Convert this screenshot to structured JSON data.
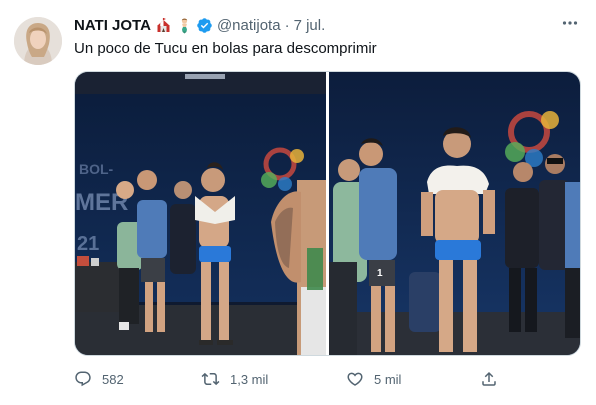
{
  "tweet": {
    "display_name": "NATI JOTA",
    "name_emojis": [
      "circus-tent-emoji",
      "merperson-emoji"
    ],
    "verified": true,
    "handle": "@natijota",
    "separator": "·",
    "date": "7 jul.",
    "text": "Un poco de Tucu en bolas para descomprimir",
    "media": [
      {
        "type": "photo",
        "description_icon": "photo-left"
      },
      {
        "type": "photo",
        "description_icon": "photo-right"
      }
    ],
    "actions": {
      "reply_count": "582",
      "retweet_count": "1,3 mil",
      "like_count": "5 mil"
    }
  },
  "colors": {
    "text_primary": "#0f1419",
    "text_secondary": "#536471",
    "verified_blue": "#1d9bf0",
    "border": "#cfd9de"
  },
  "icons": [
    "more-icon",
    "verified-badge-icon",
    "reply-icon",
    "retweet-icon",
    "like-icon",
    "share-icon"
  ]
}
